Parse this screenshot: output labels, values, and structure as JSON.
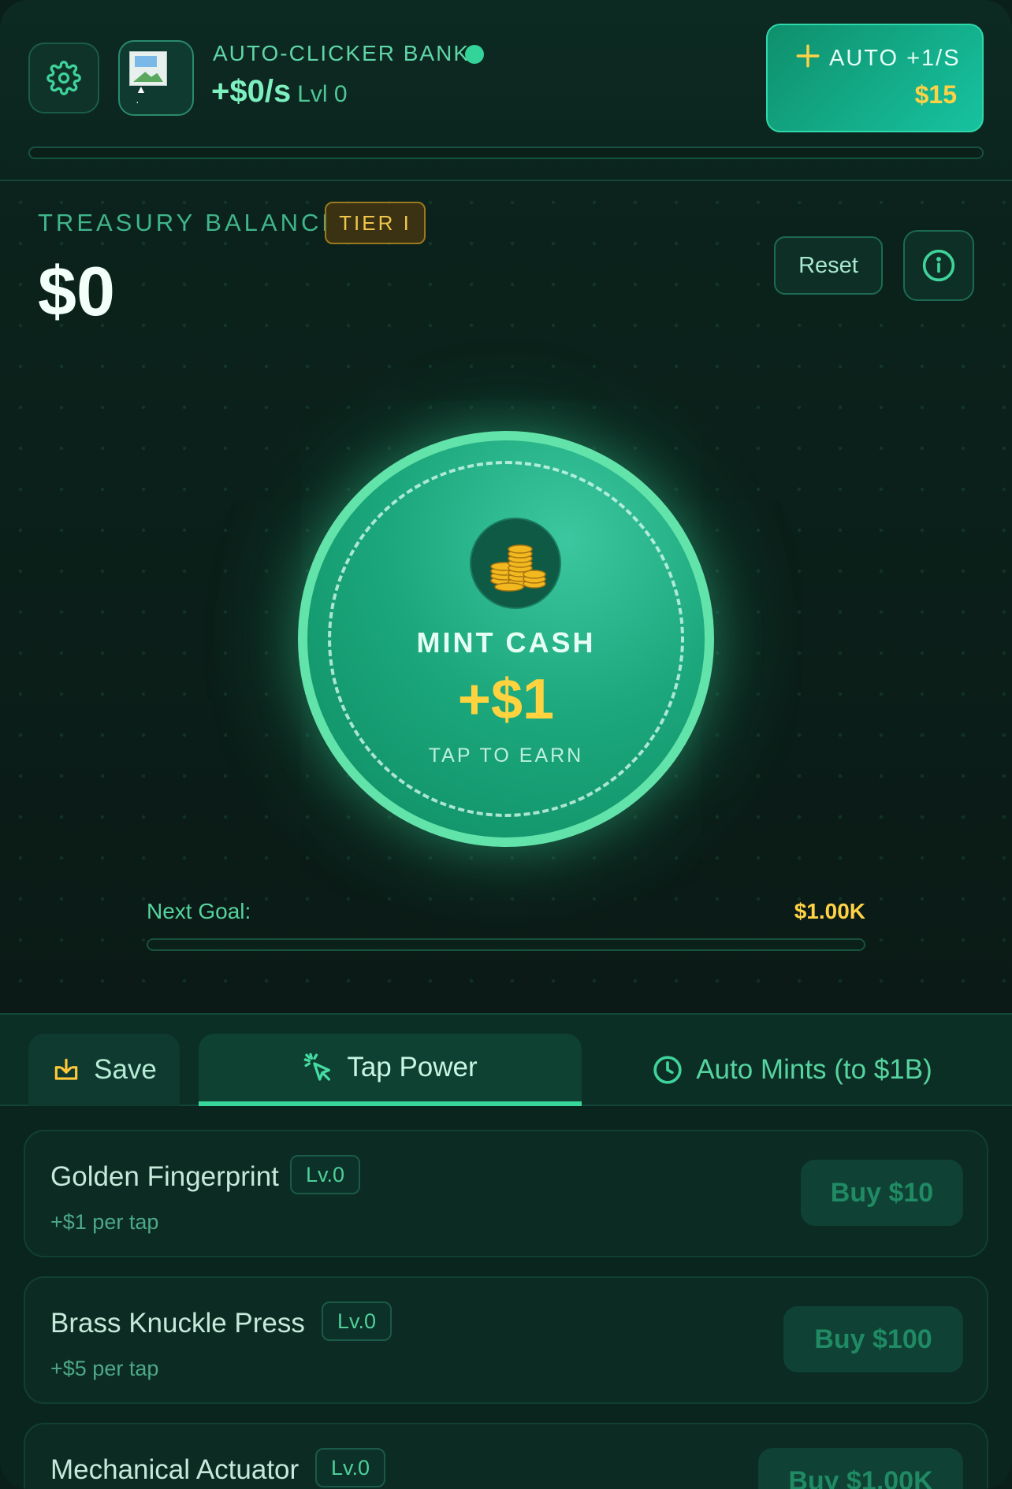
{
  "header": {
    "bank_title": "AUTO-CLICKER BANK",
    "rate": "+$0/s",
    "level": "Lvl 0",
    "auto_button": {
      "label": "AUTO +1/S",
      "price": "$15"
    },
    "progress_fraction": 0
  },
  "treasury": {
    "label": "TREASURY BALANCE",
    "tier": "TIER I",
    "balance": "$0",
    "reset_label": "Reset"
  },
  "mint": {
    "label": "MINT CASH",
    "value": "+$1",
    "hint": "TAP TO EARN"
  },
  "goal": {
    "label": "Next Goal:",
    "value": "$1.00K",
    "progress_fraction": 0
  },
  "tabs": [
    {
      "label": "Save",
      "icon": "download-tray-icon"
    },
    {
      "label": "Tap Power",
      "icon": "cursor-click-icon",
      "active": true
    },
    {
      "label": "Auto Mints (to $1B)",
      "icon": "clock-icon"
    }
  ],
  "upgrades": [
    {
      "name": "Golden Fingerprint",
      "level": "Lv.0",
      "desc": "+$1 per tap",
      "buy": "Buy $10"
    },
    {
      "name": "Brass Knuckle Press",
      "level": "Lv.0",
      "desc": "+$5 per tap",
      "buy": "Buy $100"
    },
    {
      "name": "Mechanical Actuator",
      "level": "Lv.0",
      "desc": "",
      "buy": "Buy $1.00K"
    }
  ],
  "colors": {
    "accent": "#34d39a",
    "gold": "#ffd246",
    "background": "#0b211b"
  }
}
